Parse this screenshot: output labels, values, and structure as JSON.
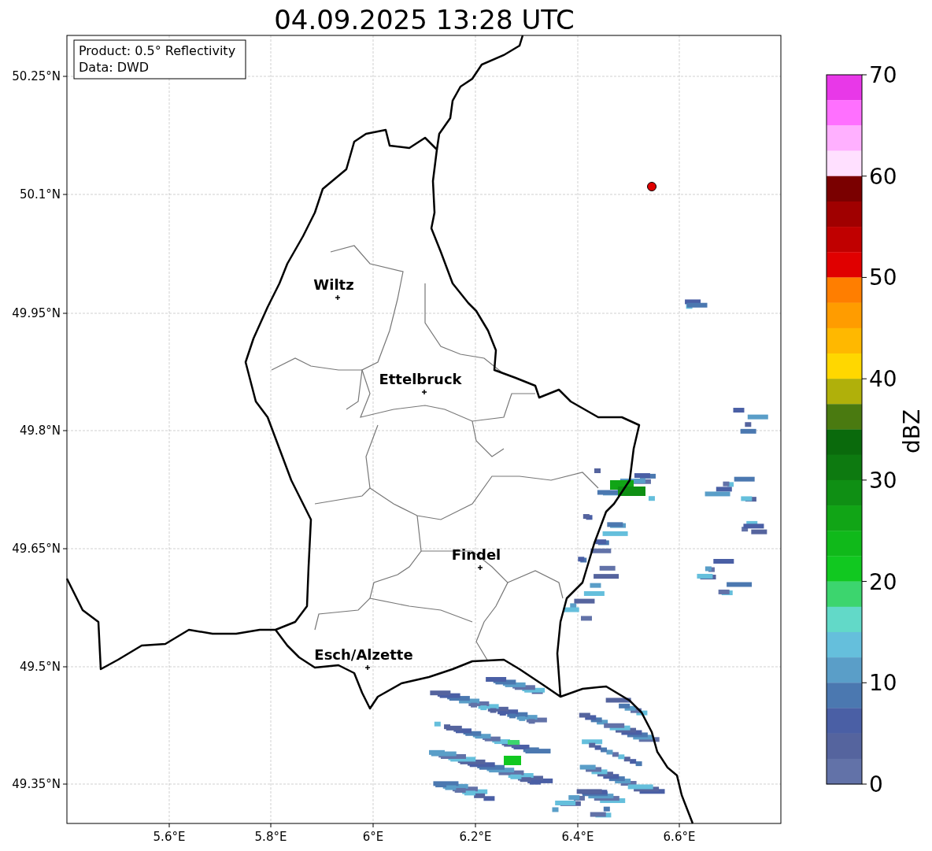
{
  "title": "04.09.2025 13:28 UTC",
  "info_box": [
    "Product: 0.5° Reflectivity",
    "Data: DWD"
  ],
  "map": {
    "x_ticks": [
      "5.6°E",
      "5.8°E",
      "6°E",
      "6.2°E",
      "6.4°E",
      "6.6°E"
    ],
    "y_ticks": [
      "50.25°N",
      "50.1°N",
      "49.95°N",
      "49.8°N",
      "49.65°N",
      "49.5°N",
      "49.35°N"
    ],
    "places": [
      {
        "name": "Wiltz"
      },
      {
        "name": "Ettelbruck"
      },
      {
        "name": "Findel"
      },
      {
        "name": "Esch/Alzette"
      }
    ]
  },
  "colorbar": {
    "label": "dBZ",
    "ticks": [
      "70",
      "60",
      "50",
      "40",
      "30",
      "20",
      "10",
      "0"
    ],
    "bins": [
      {
        "color": "#e838e8"
      },
      {
        "color": "#ff70ff"
      },
      {
        "color": "#ffb0ff"
      },
      {
        "color": "#ffe0ff"
      },
      {
        "color": "#7a0000"
      },
      {
        "color": "#a00000"
      },
      {
        "color": "#c00000"
      },
      {
        "color": "#e00000"
      },
      {
        "color": "#ff7e00"
      },
      {
        "color": "#ff9c00"
      },
      {
        "color": "#ffb800"
      },
      {
        "color": "#ffd700"
      },
      {
        "color": "#b0b00a"
      },
      {
        "color": "#4a7a10"
      },
      {
        "color": "#0a6a0c"
      },
      {
        "color": "#0d7a10"
      },
      {
        "color": "#0f8f14"
      },
      {
        "color": "#11a516"
      },
      {
        "color": "#10b91a"
      },
      {
        "color": "#11c820"
      },
      {
        "color": "#3cd56e"
      },
      {
        "color": "#62d9c8"
      },
      {
        "color": "#65bfdc"
      },
      {
        "color": "#5a9ec8"
      },
      {
        "color": "#4b78b0"
      },
      {
        "color": "#4a5fa5"
      },
      {
        "color": "#55649e"
      },
      {
        "color": "#6272a8"
      }
    ]
  }
}
